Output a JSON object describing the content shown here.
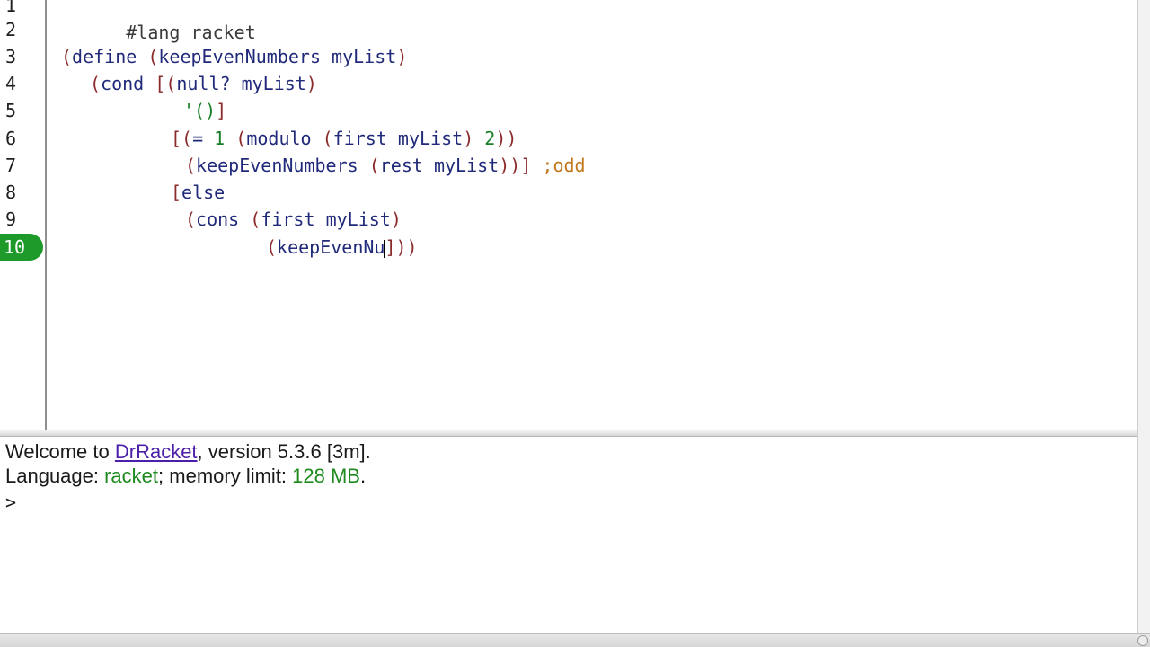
{
  "editor": {
    "line_numbers": [
      "1",
      "2",
      "3",
      "4",
      "5",
      "6",
      "7",
      "8",
      "9",
      "10"
    ],
    "current_line": "10",
    "lines": {
      "l1": {
        "lang": "#lang racket"
      },
      "l3": {
        "p1": "(",
        "define": "define",
        "p2": " (",
        "name": "keepEvenNumbers",
        "arg": " myList",
        "p3": ")"
      },
      "l4": {
        "p1": "(",
        "cond": "cond",
        "p2": " [(",
        "nullq": "null?",
        "arg": " myList",
        "p3": ")"
      },
      "l5": {
        "quote": "'()",
        "p3": "]"
      },
      "l6": {
        "p1": "[(",
        "eq": "=",
        "one": " 1",
        "p2": " (",
        "modulo": "modulo",
        "p3": " (",
        "first": "first",
        "arg": " myList",
        "p4": ")",
        "two": " 2",
        "p5": "))"
      },
      "l7": {
        "p1": "(",
        "fn": "keepEvenNumbers",
        "p2": " (",
        "rest": "rest",
        "arg": " myList",
        "p3": "))]",
        "comment": " ;odd"
      },
      "l8": {
        "p1": "[",
        "else": "else"
      },
      "l9": {
        "p1": "(",
        "cons": "cons",
        "p2": " (",
        "first": "first",
        "arg": " myList",
        "p3": ")"
      },
      "l10": {
        "p1": "(",
        "partial": "keepEvenNu",
        "p2": "]))"
      }
    }
  },
  "repl": {
    "welcome_prefix": "Welcome to ",
    "drracket_link": "DrRacket",
    "welcome_suffix": ", version 5.3.6 [3m].",
    "language_label": "Language: ",
    "language_value": "racket",
    "memory_label": "; memory limit: ",
    "memory_value": "128 MB",
    "memory_end": ".",
    "prompt": ">"
  },
  "colors": {
    "current_line_badge": "#1e9a2a",
    "link": "#4b1fa8",
    "comment": "#c2771f",
    "paren": "#8b2a2a",
    "symbol": "#212a7a",
    "constant": "#1b7f2a"
  }
}
